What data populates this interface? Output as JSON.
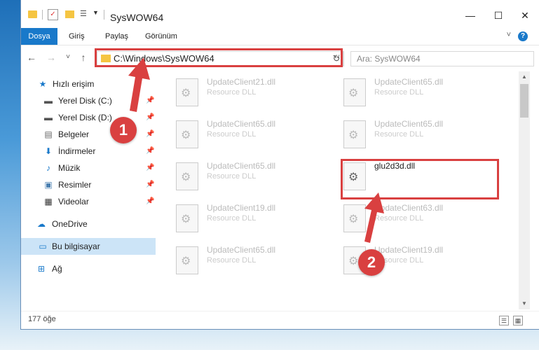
{
  "window": {
    "title": "SysWOW64"
  },
  "ribbon": {
    "tabs": [
      {
        "label": "Dosya",
        "active": true
      },
      {
        "label": "Giriş"
      },
      {
        "label": "Paylaş"
      },
      {
        "label": "Görünüm"
      }
    ],
    "help": "?"
  },
  "controls": {
    "minimize": "—",
    "maximize": "☐",
    "close": "✕"
  },
  "nav": {
    "back": "←",
    "forward": "→",
    "recent": "˅",
    "up": "↑"
  },
  "address": {
    "path": "C:\\Windows\\SysWOW64",
    "dropdown": "˅",
    "refresh": "↻"
  },
  "search": {
    "placeholder": "Ara: SysWOW64"
  },
  "sidebar": {
    "quick_access": "Hızlı erişim",
    "items": [
      {
        "label": "Yerel Disk (C:)",
        "pinned": true
      },
      {
        "label": "Yerel Disk (D:)",
        "pinned": true
      },
      {
        "label": "Belgeler",
        "pinned": true
      },
      {
        "label": "İndirmeler",
        "pinned": true
      },
      {
        "label": "Müzik",
        "pinned": true
      },
      {
        "label": "Resimler",
        "pinned": true
      },
      {
        "label": "Videolar",
        "pinned": true
      }
    ],
    "onedrive": "OneDrive",
    "this_pc": "Bu bilgisayar",
    "network": "Ağ"
  },
  "files": [
    {
      "name": "UpdateClient21.dll",
      "type": "Resource DLL"
    },
    {
      "name": "UpdateClient65.dll",
      "type": "Resource DLL"
    },
    {
      "name": "UpdateClient65.dll",
      "type": "Resource DLL"
    },
    {
      "name": "UpdateClient65.dll",
      "type": "Resource DLL"
    },
    {
      "name": "UpdateClient65.dll",
      "type": "Resource DLL"
    },
    {
      "name": "glu2d3d.dll",
      "type": ""
    },
    {
      "name": "UpdateClient19.dll",
      "type": "Resource DLL"
    },
    {
      "name": "UpdateClient63.dll",
      "type": "Resource DLL"
    },
    {
      "name": "UpdateClient65.dll",
      "type": "Resource DLL"
    },
    {
      "name": "UpdateClient19.dll",
      "type": "Resource DLL"
    }
  ],
  "status": {
    "count": "177 öğe"
  },
  "annotations": {
    "step1": "1",
    "step2": "2"
  },
  "colors": {
    "accent": "#1979ca",
    "highlight_box": "#d94040",
    "selected_bg": "#cce4f7"
  }
}
